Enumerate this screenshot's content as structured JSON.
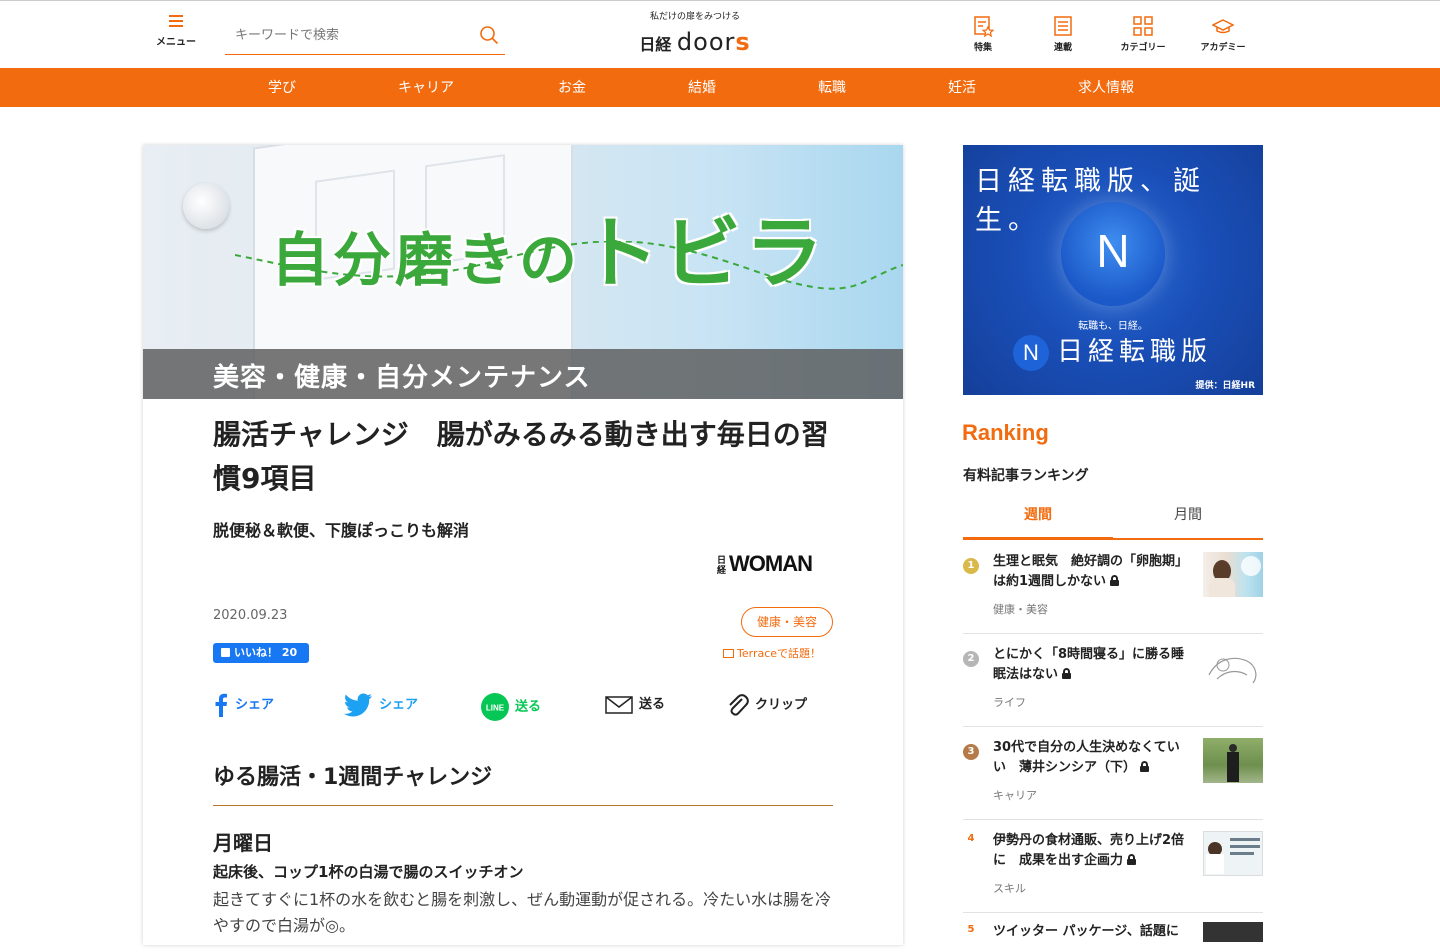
{
  "header": {
    "menu_label": "メニュー",
    "search_placeholder": "キーワードで検索",
    "logo_tagline": "私だけの扉をみつける",
    "logo_nikkei": "日経",
    "logo_doors": "door",
    "logo_s": "s",
    "nav": [
      {
        "label": "特集",
        "icon": "feature-icon"
      },
      {
        "label": "連載",
        "icon": "series-icon"
      },
      {
        "label": "カテゴリー",
        "icon": "category-icon"
      },
      {
        "label": "アカデミー",
        "icon": "academy-icon"
      }
    ]
  },
  "category_nav": [
    "学び",
    "キャリア",
    "お金",
    "結婚",
    "転職",
    "妊活",
    "求人情報"
  ],
  "article": {
    "banner_title_small": "自分磨きの",
    "banner_title_big": "トビラ",
    "banner_band": "美容・健康・自分メンテナンス",
    "title": "腸活チャレンジ　腸がみるみる動き出す毎日の習慣9項目",
    "subtitle": "脱便秘＆軟便、下腹ぽっこりも解消",
    "brand_nikkei": "日経",
    "brand": "WOMAN",
    "date": "2020.09.23",
    "tag": "健康・美容",
    "like_label": "いいね！ 20",
    "terrace_label": "Terraceで話題！",
    "share": [
      {
        "label": "シェア",
        "icon": "facebook-icon"
      },
      {
        "label": "シェア",
        "icon": "twitter-icon"
      },
      {
        "label": "送る",
        "icon": "line-icon"
      },
      {
        "label": "送る",
        "icon": "mail-icon"
      },
      {
        "label": "クリップ",
        "icon": "clip-icon"
      }
    ],
    "section_heading": "ゆる腸活・1週間チャレンジ",
    "day_heading": "月曜日",
    "day_subheading": "起床後、コップ1杯の白湯で腸のスイッチオン",
    "body": "起きてすぐに1杯の水を飲むと腸を刺激し、ぜん動運動が促される。冷たい水は腸を冷やすので白湯が◎。"
  },
  "ad": {
    "headline": "日経転職版、誕生。",
    "circle_letter": "N",
    "small_text": "転職も、日経。",
    "logo_letter": "N",
    "logo_text": "日経転職版",
    "credit": "提供：日経HR"
  },
  "ranking": {
    "heading": "Ranking",
    "subheading": "有料記事ランキング",
    "tabs": [
      "週間",
      "月間"
    ],
    "active_tab": "週間",
    "items": [
      {
        "rank": "1",
        "title": "生理と眠気　絶好調の「卵胞期」は約1週間しかない",
        "category": "健康・美容",
        "badge_color": "#d9b94a"
      },
      {
        "rank": "2",
        "title": "とにかく「8時間寝る」に勝る睡眠法はない",
        "category": "ライフ",
        "badge_color": "#b6b6b6"
      },
      {
        "rank": "3",
        "title": "30代で自分の人生決めなくていい　薄井シンシア（下）",
        "category": "キャリア",
        "badge_color": "#b57a48"
      },
      {
        "rank": "4",
        "title": "伊勢丹の食材通販、売り上げ2倍に　成果を出す企画力",
        "category": "スキル",
        "badge_color": "#f26b0f"
      },
      {
        "rank": "5",
        "title": "ツイッター パッケージ、話題に",
        "category": "",
        "badge_color": "#f26b0f"
      }
    ]
  },
  "colors": {
    "accent": "#f26b0f",
    "band": "#5a5a5a",
    "ad_blue": "#1a4fb8"
  }
}
